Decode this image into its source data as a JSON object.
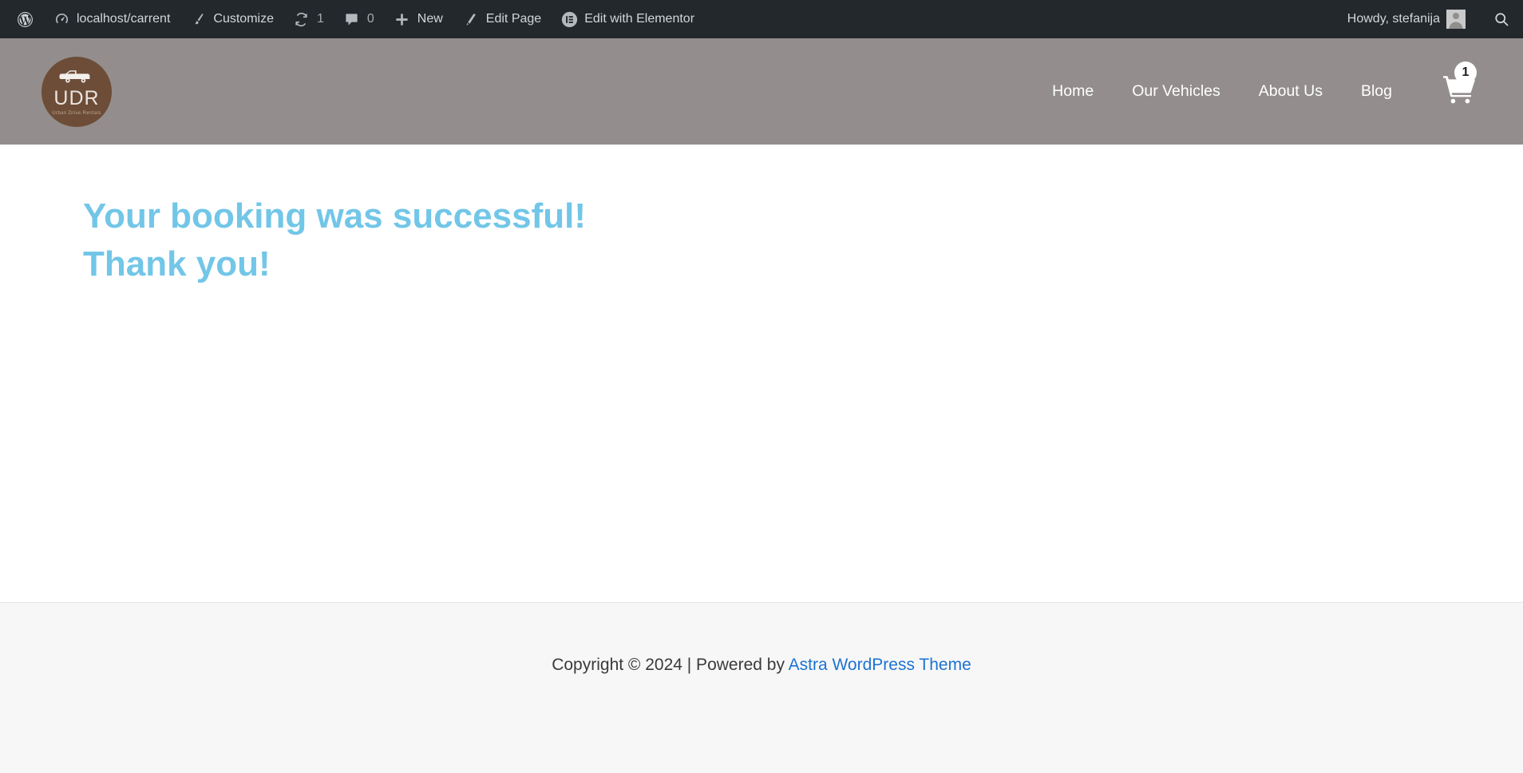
{
  "admin_bar": {
    "wp_logo_label": "About WordPress",
    "left_items": [
      {
        "id": "site-name",
        "icon": "dashboard-icon",
        "label": "localhost/carrent",
        "count": null
      },
      {
        "id": "customize",
        "icon": "paintbrush-icon",
        "label": "Customize",
        "count": null
      },
      {
        "id": "updates",
        "icon": "updates-icon",
        "label": "",
        "count": "1"
      },
      {
        "id": "comments",
        "icon": "comment-icon",
        "label": "",
        "count": "0"
      },
      {
        "id": "new-content",
        "icon": "plus-icon",
        "label": "New",
        "count": null
      },
      {
        "id": "edit-page",
        "icon": "pencil-icon",
        "label": "Edit Page",
        "count": null
      },
      {
        "id": "edit-elementor",
        "icon": "elementor-icon",
        "label": "Edit with Elementor",
        "count": null
      }
    ],
    "account_greeting": "Howdy, stefanija",
    "search_icon": "search-icon",
    "avatar_icon": "user-avatar-icon",
    "background_color": "#23282d"
  },
  "header": {
    "background_color": "#938e8d",
    "logo": {
      "icon": "pickup-truck-icon",
      "initials": "UDR",
      "tagline": "Urban Drive Rentals",
      "circle_color": "#6d4d37"
    },
    "nav_items": [
      {
        "label": "Home"
      },
      {
        "label": "Our Vehicles"
      },
      {
        "label": "About Us"
      },
      {
        "label": "Blog"
      }
    ],
    "cart": {
      "icon": "shopping-cart-icon",
      "count": "1"
    }
  },
  "main": {
    "heading_line1": "Your booking was successful!",
    "heading_line2": "Thank you!",
    "heading_color": "#72c6e7"
  },
  "footer": {
    "background_color": "#f7f7f7",
    "copyright_text": "Copyright © 2024 | Powered by ",
    "theme_link_text": "Astra WordPress Theme",
    "link_color": "#1e73d2"
  }
}
